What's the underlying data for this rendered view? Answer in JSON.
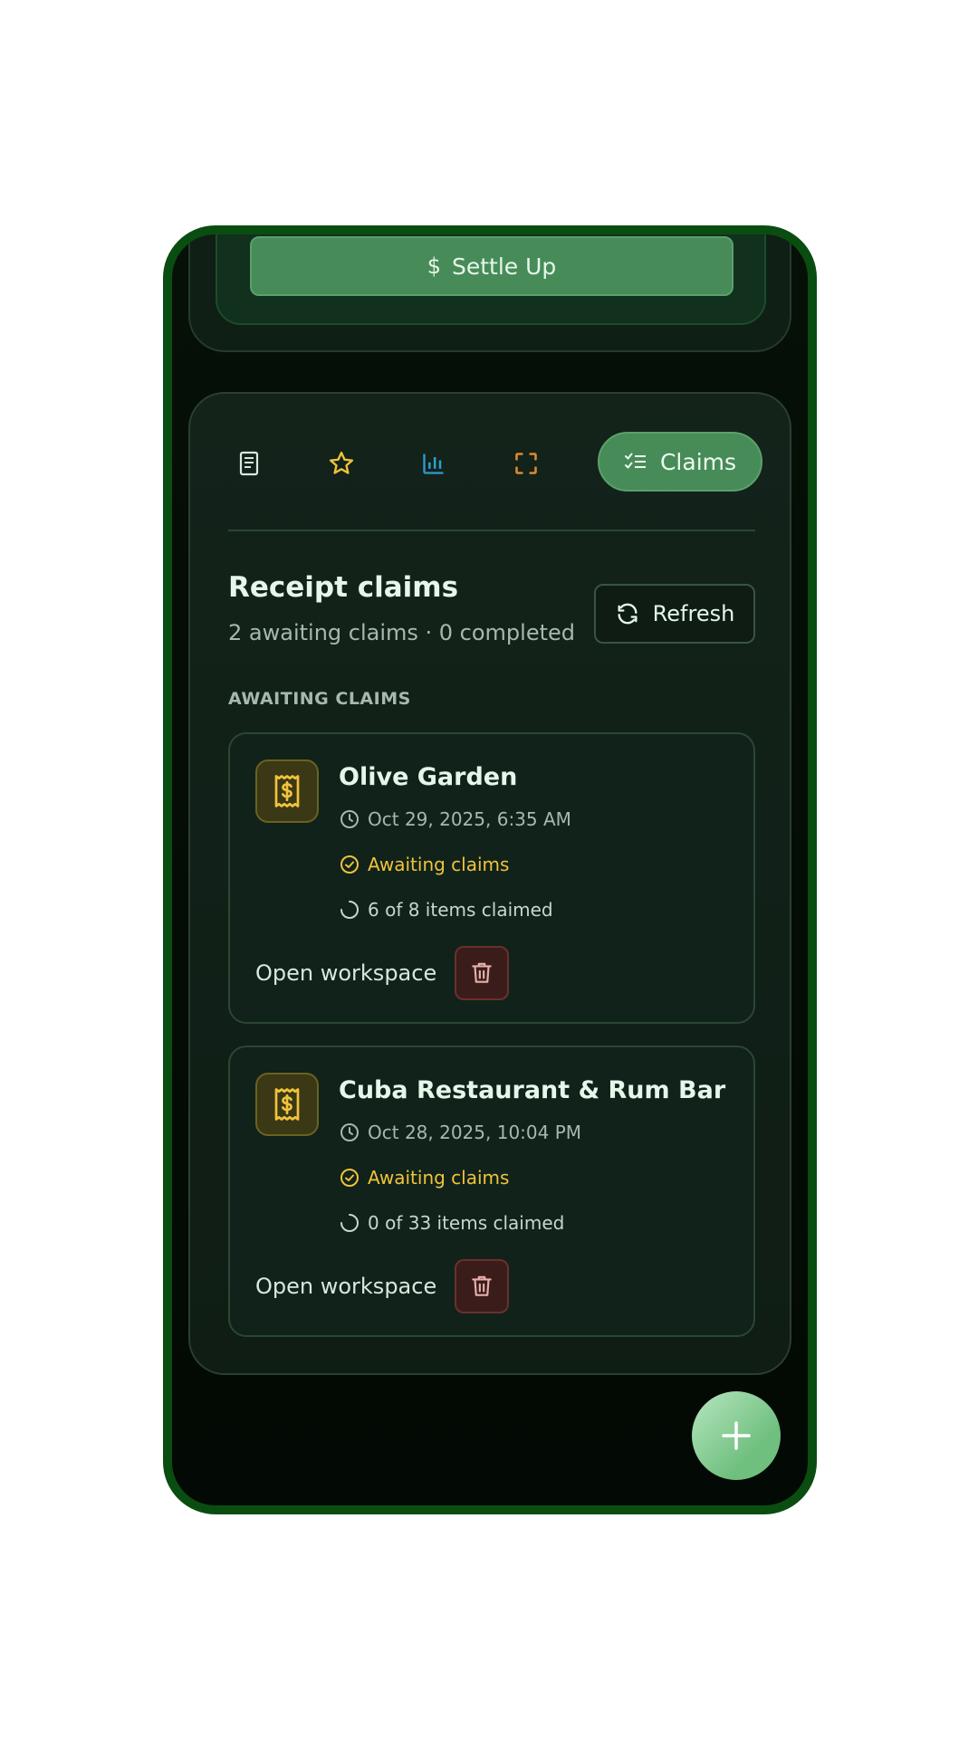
{
  "top_card": {
    "settle_label": "Settle Up",
    "dollar_glyph": "$"
  },
  "tabs": {
    "items": [
      {
        "name": "receipt-tab",
        "icon": "receipt-icon",
        "color": "#d8e8dc"
      },
      {
        "name": "favorites-tab",
        "icon": "star-icon",
        "color": "#f0c33a"
      },
      {
        "name": "stats-tab",
        "icon": "bar-chart-icon",
        "color": "#2e9ccc"
      },
      {
        "name": "scan-tab",
        "icon": "scan-frame-icon",
        "color": "#e08a2a"
      }
    ],
    "active_label": "Claims"
  },
  "section": {
    "title": "Receipt claims",
    "subtitle": "2 awaiting claims · 0 completed",
    "refresh_label": "Refresh",
    "awaiting_header": "AWAITING CLAIMS"
  },
  "claims": [
    {
      "title": "Olive Garden",
      "date": "Oct 29, 2025, 6:35 AM",
      "status": "Awaiting claims",
      "progress": "6 of 8 items claimed",
      "action_label": "Open workspace"
    },
    {
      "title": "Cuba Restaurant & Rum Bar",
      "date": "Oct 28, 2025, 10:04 PM",
      "status": "Awaiting claims",
      "progress": "0 of 33 items claimed",
      "action_label": "Open workspace"
    }
  ],
  "colors": {
    "accent": "#478c58",
    "status_yellow": "#f0c33a",
    "frame_green": "#0a4d10",
    "danger_bg": "#3a1d1b"
  }
}
